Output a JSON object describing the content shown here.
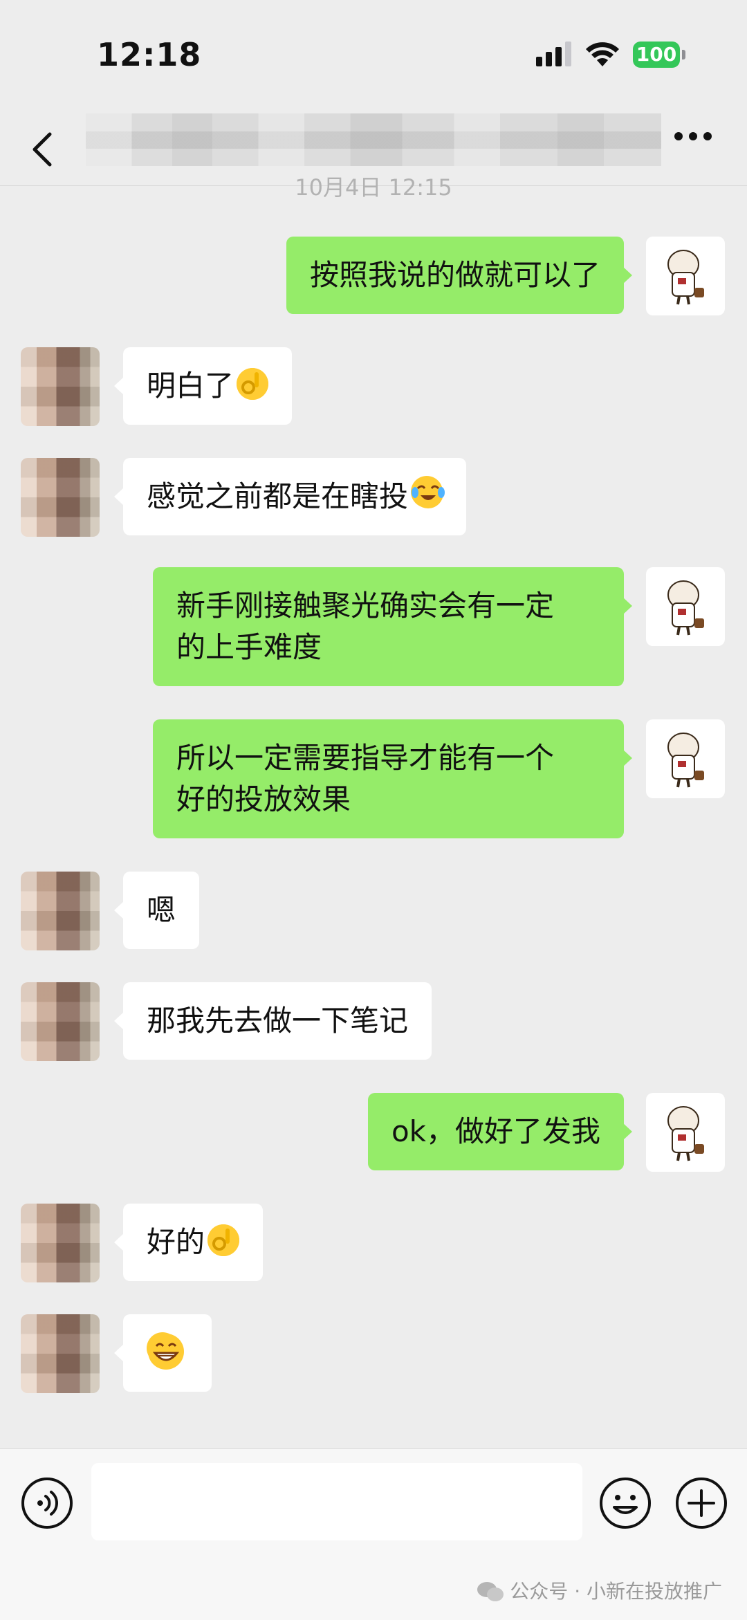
{
  "status_bar": {
    "time": "12:18",
    "battery": "100"
  },
  "nav": {
    "title": ""
  },
  "timestamp": "10月4日 12:15",
  "messages": [
    {
      "side": "out",
      "text": "按照我说的做就可以了"
    },
    {
      "side": "in",
      "text": "明白了",
      "emoji": "ok-hand-emoji"
    },
    {
      "side": "in",
      "text": "感觉之前都是在瞎投",
      "emoji": "laugh-cry-emoji"
    },
    {
      "side": "out",
      "line1": "新手刚接触聚光确实会有一定",
      "line2": "的上手难度"
    },
    {
      "side": "out",
      "line1": "所以一定需要指导才能有一个",
      "line2": "好的投放效果"
    },
    {
      "side": "in",
      "text": "嗯"
    },
    {
      "side": "in",
      "text": "那我先去做一下笔记"
    },
    {
      "side": "out",
      "text": "ok，做好了发我"
    },
    {
      "side": "in",
      "text": "好的",
      "emoji": "ok-hand-emoji"
    },
    {
      "side": "in",
      "text": "",
      "emoji": "grinning-emoji"
    }
  ],
  "input": {
    "value": ""
  },
  "watermark": "公众号 · 小新在投放推广",
  "colors": {
    "bg": "#ededed",
    "bubble_out": "#95ec69",
    "bubble_in": "#ffffff",
    "battery": "#34c759"
  }
}
